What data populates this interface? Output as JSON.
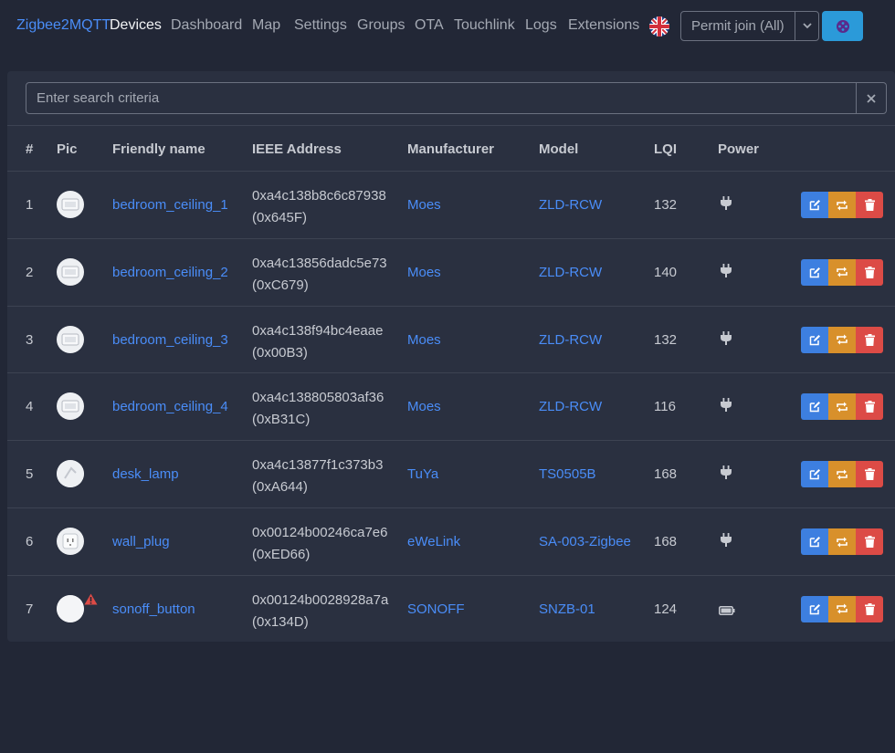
{
  "nav": {
    "brand": "Zigbee2MQTT",
    "links": [
      "Devices",
      "Dashboard",
      "Map",
      "Settings",
      "Groups",
      "OTA",
      "Touchlink",
      "Logs",
      "Extensions"
    ],
    "active": "Devices",
    "permit_join": "Permit join (All)",
    "language_icon": "uk-flag-icon",
    "settings_icon": "gear-icon"
  },
  "search": {
    "placeholder": "Enter search criteria"
  },
  "table": {
    "columns": [
      "#",
      "Pic",
      "Friendly name",
      "IEEE Address",
      "Manufacturer",
      "Model",
      "LQI",
      "Power"
    ],
    "rows": [
      {
        "num": "1",
        "name": "bedroom_ceiling_1",
        "ieee": "0xa4c138b8c6c87938",
        "nwk": "(0x645F)",
        "manufacturer": "Moes",
        "model": "ZLD-RCW",
        "lqi": "132",
        "power": "plug-icon"
      },
      {
        "num": "2",
        "name": "bedroom_ceiling_2",
        "ieee": "0xa4c13856dadc5e73",
        "nwk": "(0xC679)",
        "manufacturer": "Moes",
        "model": "ZLD-RCW",
        "lqi": "140",
        "power": "plug-icon"
      },
      {
        "num": "3",
        "name": "bedroom_ceiling_3",
        "ieee": "0xa4c138f94bc4eaae",
        "nwk": "(0x00B3)",
        "manufacturer": "Moes",
        "model": "ZLD-RCW",
        "lqi": "132",
        "power": "plug-icon"
      },
      {
        "num": "4",
        "name": "bedroom_ceiling_4",
        "ieee": "0xa4c138805803af36",
        "nwk": "(0xB31C)",
        "manufacturer": "Moes",
        "model": "ZLD-RCW",
        "lqi": "116",
        "power": "plug-icon"
      },
      {
        "num": "5",
        "name": "desk_lamp",
        "ieee": "0xa4c13877f1c373b3",
        "nwk": "(0xA644)",
        "manufacturer": "TuYa",
        "model": "TS0505B",
        "lqi": "168",
        "power": "plug-icon"
      },
      {
        "num": "6",
        "name": "wall_plug",
        "ieee": "0x00124b00246ca7e6",
        "nwk": "(0xED66)",
        "manufacturer": "eWeLink",
        "model": "SA-003-Zigbee",
        "lqi": "168",
        "power": "plug-icon"
      },
      {
        "num": "7",
        "name": "sonoff_button",
        "ieee": "0x00124b0028928a7a",
        "nwk": "(0x134D)",
        "manufacturer": "SONOFF",
        "model": "SNZB-01",
        "lqi": "124",
        "power": "battery-icon",
        "warning": true
      }
    ]
  },
  "colors": {
    "background": "#222736",
    "card": "#2a3040",
    "link": "#4a8df8",
    "edit": "#3d7fe0",
    "reconfigure": "#d8902b",
    "delete": "#dc4b46",
    "settings_button": "#2b9ad9"
  }
}
